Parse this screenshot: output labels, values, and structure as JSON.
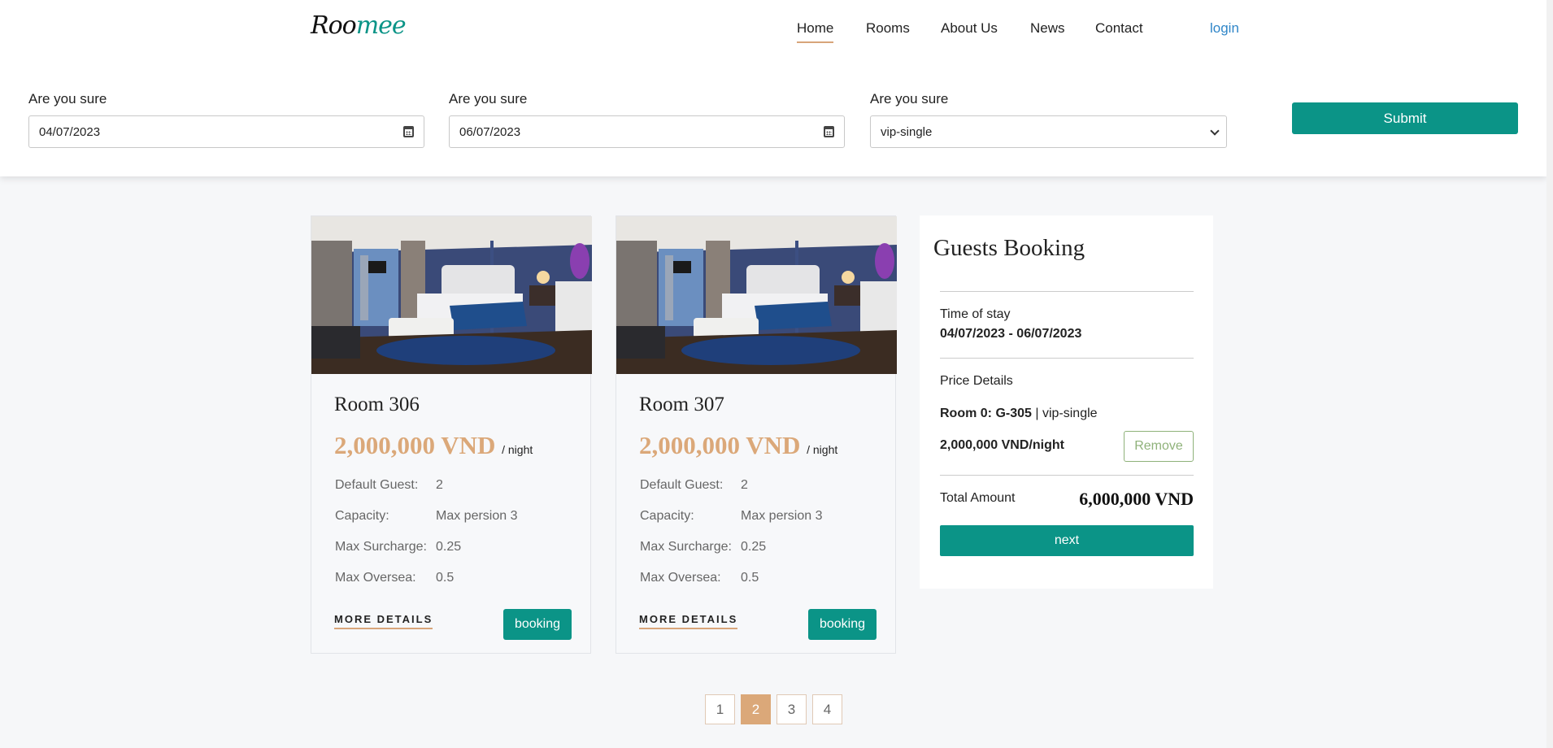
{
  "header": {
    "logo_part1": "Roo",
    "logo_part2": "mee",
    "nav": [
      "Home",
      "Rooms",
      "About Us",
      "News",
      "Contact"
    ],
    "active_nav": "Home",
    "login": "login"
  },
  "search": {
    "checkin_label": "Are you sure",
    "checkin_value": "04/07/2023",
    "checkout_label": "Are you sure",
    "checkout_value": "06/07/2023",
    "roomtype_label": "Are you sure",
    "roomtype_value": "vip-single",
    "submit": "Submit"
  },
  "rooms": [
    {
      "title": "Room 306",
      "price": "2,000,000 VND",
      "per_night": "/ night",
      "specs": [
        {
          "key": "Default Guest:",
          "value": "2"
        },
        {
          "key": "Capacity:",
          "value": "Max persion 3"
        },
        {
          "key": "Max Surcharge:",
          "value": "0.25"
        },
        {
          "key": "Max Oversea:",
          "value": "0.5"
        }
      ],
      "more": "MORE DETAILS",
      "book": "booking"
    },
    {
      "title": "Room 307",
      "price": "2,000,000 VND",
      "per_night": "/ night",
      "specs": [
        {
          "key": "Default Guest:",
          "value": "2"
        },
        {
          "key": "Capacity:",
          "value": "Max persion 3"
        },
        {
          "key": "Max Surcharge:",
          "value": "0.25"
        },
        {
          "key": "Max Oversea:",
          "value": "0.5"
        }
      ],
      "more": "MORE DETAILS",
      "book": "booking"
    }
  ],
  "booking": {
    "title": "Guests Booking",
    "stay_label": "Time of stay",
    "stay_value": "04/07/2023 - 06/07/2023",
    "price_details": "Price Details",
    "room_line_bold": "Room 0: G-305",
    "room_line_rest": " | vip-single",
    "room_price": "2,000,000 VND/night",
    "remove": "Remove",
    "total_label": "Total Amount",
    "total_value": "6,000,000 VND",
    "next": "next"
  },
  "pagination": {
    "pages": [
      "1",
      "2",
      "3",
      "4"
    ],
    "current": "2"
  },
  "colors": {
    "accent": "#0b9487",
    "price": "#dba879",
    "link": "#2f86c8",
    "remove": "#8fb27a"
  }
}
